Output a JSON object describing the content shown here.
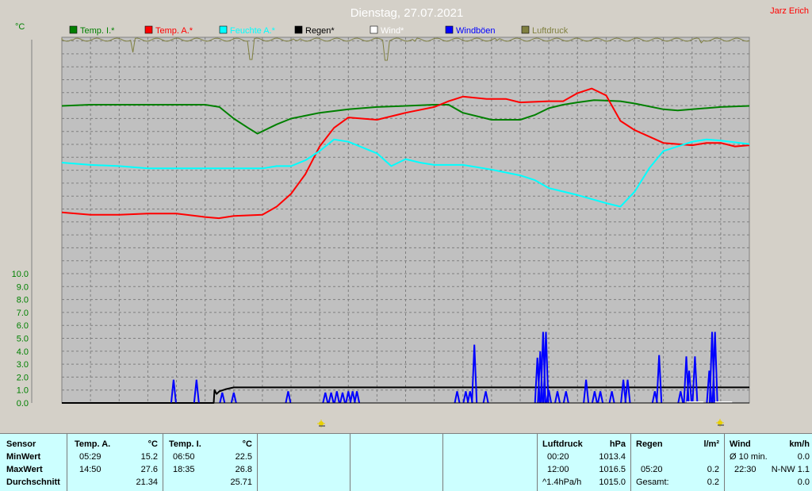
{
  "title": "Dienstag, 27.07.2021",
  "station": "Jarz Erich",
  "unit_top": "°C",
  "legend": [
    {
      "label": "Temp. I.*",
      "color": "#008000"
    },
    {
      "label": "Temp. A.*",
      "color": "#ff0000"
    },
    {
      "label": "Feuchte A.*",
      "color": "#00ffff"
    },
    {
      "label": "Regen*",
      "color": "#000000"
    },
    {
      "label": "Wind*",
      "color": "#ffffff"
    },
    {
      "label": "Windböen",
      "color": "#0000ff"
    },
    {
      "label": "Luftdruck",
      "color": "#808040"
    }
  ],
  "chart_data": {
    "type": "line",
    "x_range_hours": [
      0,
      24
    ],
    "y_ticks": [
      "0.0",
      "1.0",
      "2.0",
      "3.0",
      "4.0",
      "5.0",
      "6.0",
      "7.0",
      "8.0",
      "9.0",
      "10.0"
    ],
    "ylim": [
      0,
      10
    ],
    "grid": true,
    "series": [
      {
        "name": "Temp. I.*",
        "color": "#008000",
        "x": [
          0,
          1,
          2,
          3,
          4,
          5,
          5.5,
          6,
          6.5,
          6.83,
          7.5,
          8,
          9,
          10,
          11,
          12,
          13,
          13.5,
          14,
          15,
          16,
          16.5,
          17,
          17.5,
          18,
          18.58,
          19.5,
          20,
          21,
          21.5,
          22,
          23,
          24
        ],
        "y": [
          24.9,
          25.0,
          25.0,
          25.0,
          25.0,
          25.0,
          24.8,
          23.8,
          23.0,
          22.5,
          23.3,
          23.8,
          24.3,
          24.6,
          24.8,
          24.9,
          25.0,
          25.0,
          24.3,
          23.7,
          23.7,
          24.1,
          24.7,
          25.0,
          25.2,
          25.4,
          25.3,
          25.1,
          24.6,
          24.5,
          24.6,
          24.8,
          24.9
        ]
      },
      {
        "name": "Temp. A.*",
        "color": "#ff0000",
        "x": [
          0,
          1,
          2,
          3,
          4,
          5,
          5.48,
          6,
          7,
          7.5,
          8,
          8.5,
          9,
          9.5,
          10,
          11,
          12,
          13,
          13.5,
          14,
          14.83,
          15.5,
          16,
          17,
          17.5,
          18,
          18.5,
          19,
          19.5,
          20,
          21,
          22,
          22.5,
          23,
          23.5,
          24
        ],
        "y": [
          15.7,
          15.5,
          15.5,
          15.6,
          15.6,
          15.3,
          15.2,
          15.4,
          15.5,
          16.2,
          17.3,
          19.0,
          21.4,
          23.0,
          23.9,
          23.7,
          24.3,
          24.8,
          25.3,
          25.7,
          25.5,
          25.5,
          25.2,
          25.3,
          25.3,
          26.0,
          26.4,
          25.8,
          23.6,
          22.8,
          21.7,
          21.5,
          21.7,
          21.7,
          21.4,
          21.5
        ]
      },
      {
        "name": "Feuchte A.*",
        "color": "#00ffff",
        "x": [
          0,
          1,
          2,
          3,
          4,
          5,
          6,
          7,
          7.5,
          8,
          8.5,
          9,
          9.5,
          10,
          11,
          11.5,
          12,
          12.5,
          13,
          13.5,
          14,
          15,
          16,
          16.5,
          17,
          18,
          19,
          19.5,
          20,
          20.5,
          21,
          22,
          22.5,
          23,
          24
        ],
        "y": [
          20.0,
          19.8,
          19.7,
          19.5,
          19.5,
          19.5,
          19.5,
          19.5,
          19.7,
          19.7,
          20.2,
          21.0,
          22.0,
          21.8,
          20.8,
          19.7,
          20.3,
          20.0,
          19.8,
          19.8,
          19.8,
          19.4,
          18.9,
          18.5,
          17.8,
          17.2,
          16.5,
          16.2,
          17.5,
          19.5,
          21.0,
          21.8,
          22.0,
          21.9,
          21.6
        ]
      },
      {
        "name": "Regen*",
        "color": "#000000",
        "x": [
          0,
          5.3,
          5.33,
          5.4,
          5.5,
          5.7,
          6.0,
          24
        ],
        "y": [
          0,
          0,
          1.0,
          0.7,
          0.9,
          1.05,
          1.2,
          1.2
        ]
      },
      {
        "name": "Windböen",
        "color": "#0000ff",
        "spikes": [
          [
            3.9,
            1.8
          ],
          [
            4.7,
            1.8
          ],
          [
            5.6,
            0.8
          ],
          [
            6.0,
            0.8
          ],
          [
            7.9,
            0.9
          ],
          [
            9.2,
            0.8
          ],
          [
            9.4,
            0.8
          ],
          [
            9.6,
            0.9
          ],
          [
            9.8,
            0.8
          ],
          [
            10.0,
            0.9
          ],
          [
            10.15,
            0.9
          ],
          [
            10.3,
            0.9
          ],
          [
            13.8,
            0.9
          ],
          [
            14.1,
            0.9
          ],
          [
            14.25,
            0.9
          ],
          [
            14.4,
            4.5
          ],
          [
            14.8,
            0.9
          ],
          [
            16.6,
            3.5
          ],
          [
            16.7,
            4.0
          ],
          [
            16.8,
            5.5
          ],
          [
            16.9,
            5.5
          ],
          [
            17.0,
            1.0
          ],
          [
            17.3,
            0.9
          ],
          [
            17.6,
            0.9
          ],
          [
            18.3,
            1.8
          ],
          [
            18.6,
            0.9
          ],
          [
            18.8,
            0.9
          ],
          [
            19.2,
            0.9
          ],
          [
            19.6,
            1.8
          ],
          [
            19.75,
            1.8
          ],
          [
            20.7,
            0.9
          ],
          [
            20.85,
            3.7
          ],
          [
            21.6,
            0.9
          ],
          [
            21.8,
            3.6
          ],
          [
            21.9,
            2.5
          ],
          [
            22.1,
            3.6
          ],
          [
            22.6,
            2.5
          ],
          [
            22.7,
            5.5
          ],
          [
            22.8,
            5.5
          ]
        ]
      },
      {
        "name": "Luftdruck",
        "color": "#808040",
        "dips": [
          [
            0.4,
            2
          ],
          [
            2.5,
            18
          ],
          [
            4.4,
            3
          ],
          [
            6.6,
            27
          ],
          [
            8.2,
            3
          ],
          [
            11.3,
            28
          ],
          [
            12.3,
            4
          ],
          [
            15.2,
            3
          ],
          [
            20.5,
            3
          ],
          [
            22.3,
            6
          ],
          [
            23.2,
            3
          ]
        ]
      }
    ]
  },
  "table": {
    "sensor": {
      "head": "Sensor",
      "min": "MinWert",
      "max": "MaxWert",
      "avg": "Durchschnitt"
    },
    "temp_a": {
      "head": "Temp. A.",
      "unit": "°C",
      "min_time": "05:29",
      "min_val": "15.2",
      "max_time": "14:50",
      "max_val": "27.6",
      "avg": "21.34"
    },
    "temp_i": {
      "head": "Temp. I.",
      "unit": "°C",
      "min_time": "06:50",
      "min_val": "22.5",
      "max_time": "18:35",
      "max_val": "26.8",
      "avg": "25.71"
    },
    "druck": {
      "head": "Luftdruck",
      "unit": "hPa",
      "min_time": "00:20",
      "min_val": "1013.4",
      "max_time": "12:00",
      "max_val": "1016.5",
      "trend": "^1.4hPa/h",
      "avg": "1015.0"
    },
    "regen": {
      "head": "Regen",
      "unit": "l/m²",
      "max_time": "05:20",
      "max_val": "0.2",
      "total_label": "Gesamt:",
      "total": "0.2"
    },
    "wind": {
      "head": "Wind",
      "unit": "km/h",
      "min_label": "Ø 10 min.",
      "min_val": "0.0",
      "max_time": "22:30",
      "max_val": "N-NW 1.1",
      "avg": "0.0"
    }
  }
}
